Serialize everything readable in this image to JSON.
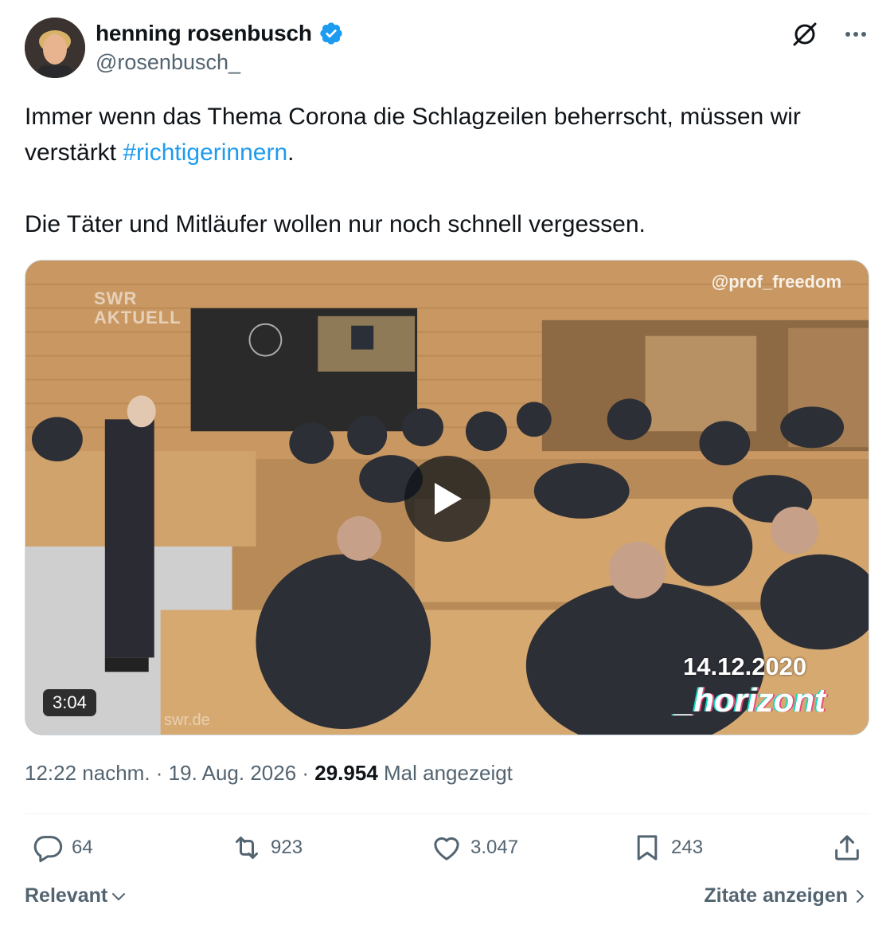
{
  "author": {
    "display_name": "henning rosenbusch",
    "handle": "@rosenbusch_",
    "verified_icon": "verified-badge-icon",
    "verified_color": "#1d9bf0"
  },
  "tweet": {
    "text_line1": "Immer wenn das Thema Corona die Schlagzeilen beherrscht, müssen wir",
    "text_line2_prefix": "verstärkt ",
    "hashtag": "#richtigerinnern",
    "text_line2_suffix": ".",
    "text_line3": "Die Täter und Mitläufer wollen nur noch schnell vergessen.",
    "hashtag_color": "#1d9bf0"
  },
  "media": {
    "duration": "3:04",
    "watermark_top_right": "@prof_freedom",
    "watermark_top_left_1": "SWR",
    "watermark_top_left_2": "AKTUELL",
    "watermark_date": "14.12.2020",
    "watermark_brand": "_horizont",
    "watermark_bottom_left": "swr.de"
  },
  "meta": {
    "time": "12:22 nachm.",
    "separator": " · ",
    "date": "19. Aug. 2026",
    "views_count": "29.954",
    "views_label": " Mal angezeigt"
  },
  "actions": {
    "replies": "64",
    "reposts": "923",
    "likes": "3.047",
    "bookmarks": "243"
  },
  "footer": {
    "sort_label": "Relevant",
    "quotes_label": "Zitate anzeigen"
  },
  "colors": {
    "text_primary": "#0f1419",
    "text_secondary": "#536471",
    "accent": "#1d9bf0"
  }
}
